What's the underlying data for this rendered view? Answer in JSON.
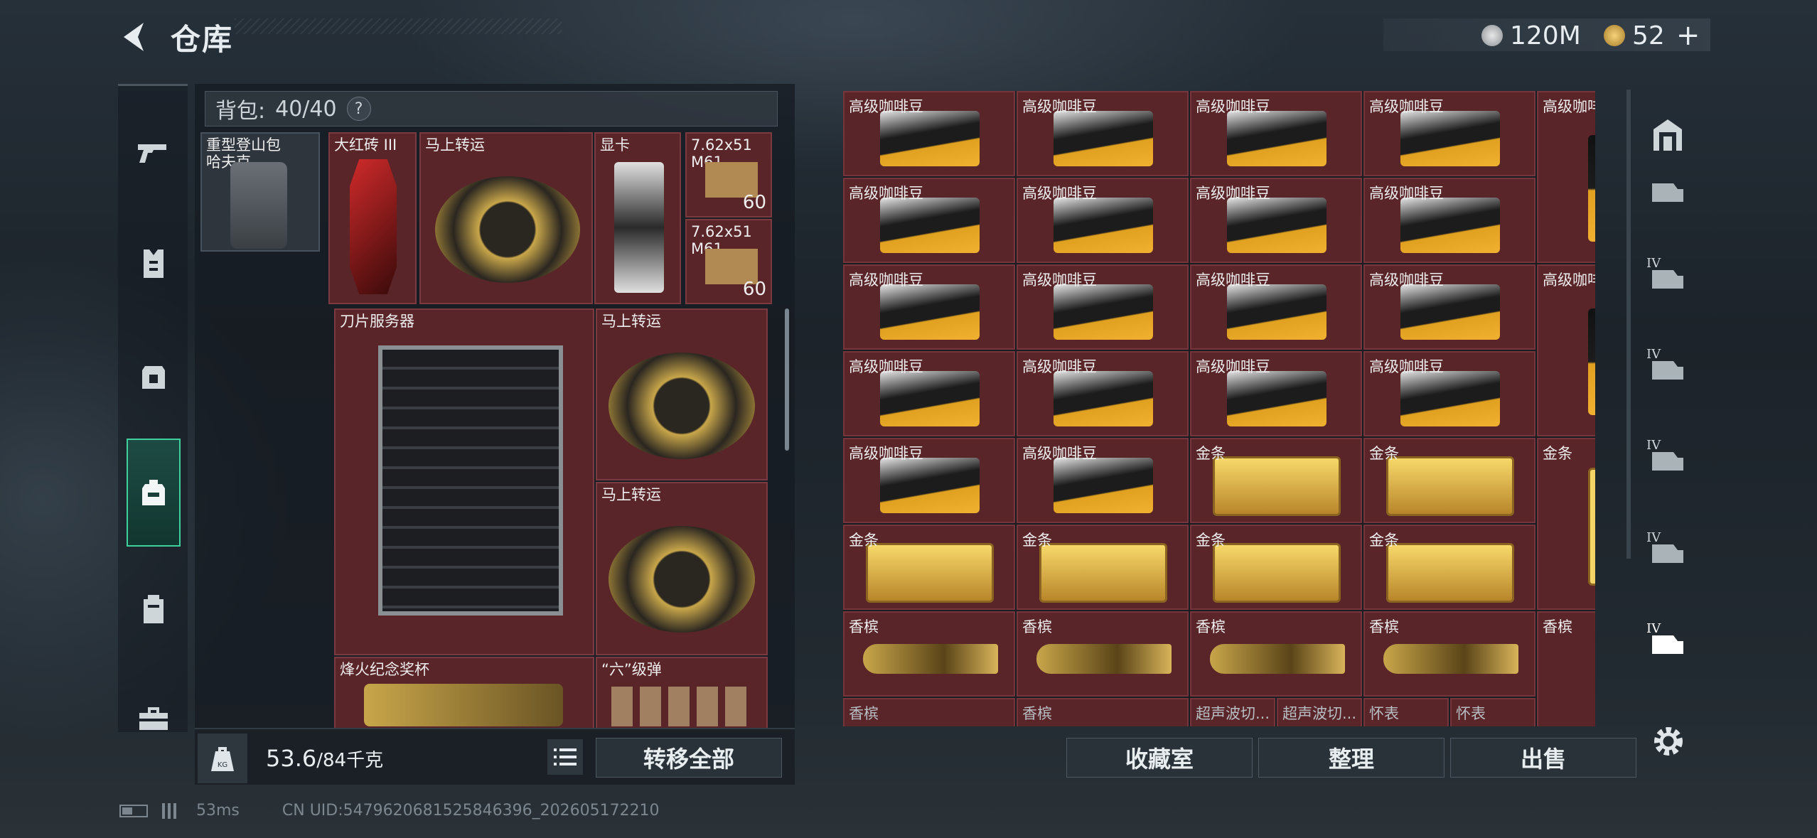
{
  "header": {
    "title": "仓库",
    "currency_1": "120M",
    "currency_2": "52",
    "add_symbol": "+"
  },
  "bag": {
    "label": "背包:",
    "capacity": "40/40",
    "help": "?",
    "items": [
      {
        "label": "重型登山包\n哈夫克",
        "count": ""
      },
      {
        "label": "大红砖 III",
        "count": ""
      },
      {
        "label": "马上转运",
        "count": ""
      },
      {
        "label": "显卡",
        "count": ""
      },
      {
        "label": "7.62x51\nM61",
        "count": "60"
      },
      {
        "label": "7.62x51\nM61",
        "count": "60"
      },
      {
        "label": "刀片服务器",
        "count": ""
      },
      {
        "label": "马上转运",
        "count": ""
      },
      {
        "label": "马上转运",
        "count": ""
      },
      {
        "label": "烽火纪念奖杯",
        "count": ""
      },
      {
        "label": "“六”级弹",
        "count": ""
      }
    ],
    "weight_value": "53.6",
    "weight_max": "/84千克",
    "kg_icon": "KG",
    "transfer_all": "转移全部"
  },
  "stash": {
    "cells": [
      "高级咖啡豆",
      "高级咖啡豆",
      "高级咖啡豆",
      "高级咖啡豆",
      "高级咖啡豆",
      "高级咖啡豆",
      "高级咖啡豆",
      "高级咖啡豆",
      "高级咖啡豆",
      "高级咖啡豆",
      "高级咖啡豆",
      "高级咖啡豆",
      "高级咖啡豆",
      "高级咖啡豆",
      "高级咖啡豆",
      "高级咖啡豆",
      "高级咖啡豆",
      "高级咖啡豆",
      "高级咖啡豆",
      "高级咖啡豆",
      "金条",
      "金条",
      "金条",
      "金条",
      "金条",
      "金条",
      "金条",
      "香槟",
      "香槟",
      "香槟",
      "香槟",
      "香槟",
      "香槟",
      "香槟",
      "超声波切...",
      "超声波切...",
      "怀表",
      "怀表"
    ],
    "collection_room": "收藏室",
    "organize": "整理",
    "sell": "出售"
  },
  "rail": {
    "iv_label": "IV"
  },
  "footer": {
    "ping": "53ms",
    "uid": "CN UID:5479620681525846396_202605172210"
  },
  "colors": {
    "accent": "#3fd0a0",
    "slot_red": "#5a2529",
    "panel": "#1a2026"
  }
}
